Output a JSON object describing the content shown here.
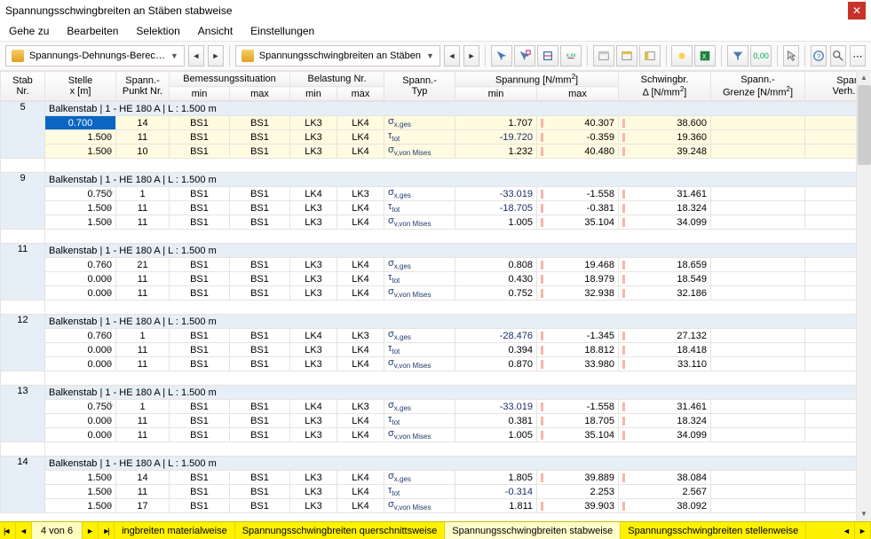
{
  "title": "Spannungsschwingbreiten an Stäben stabweise",
  "menu": [
    "Gehe zu",
    "Bearbeiten",
    "Selektion",
    "Ansicht",
    "Einstellungen"
  ],
  "toolbar": {
    "drop1": "Spannungs-Dehnungs-Berec…",
    "drop2": "Spannungsschwingbreiten an Stäben"
  },
  "headers": {
    "nr": "Stab\nNr.",
    "stelle": "Stelle\nx [m]",
    "punkt": "Spann.-\nPunkt Nr.",
    "bs": "Bemessungssituation",
    "bs_min": "min",
    "bs_max": "max",
    "lk": "Belastung Nr.",
    "lk_min": "min",
    "lk_max": "max",
    "typ": "Spann.-\nTyp",
    "spn": "Spannung [N/mm²]",
    "spn_min": "min",
    "spn_max": "max",
    "delta": "Schwingbr.\nΔ [N/mm²]",
    "grenze": "Spann.-\nGrenze [N/mm²]",
    "verh": "Spann.-\nVerh. η [-]"
  },
  "groups": [
    {
      "nr": "5",
      "label": "Balkenstab | 1 - HE 180 A | L : 1.500 m",
      "rows": [
        {
          "sel": true,
          "stelle": "0.700",
          "glyph": "",
          "punkt": "14",
          "bsmin": "BS1",
          "bsmax": "BS1",
          "lkmin": "LK3",
          "lkmax": "LK4",
          "typ": "σ<sub>x,ges</sub>",
          "smin": "1.707",
          "smax": "40.307",
          "delta": "38.600",
          "bar": true
        },
        {
          "sel": true,
          "stelle": "1.500",
          "glyph": "⊼",
          "punkt": "11",
          "bsmin": "BS1",
          "bsmax": "BS1",
          "lkmin": "LK3",
          "lkmax": "LK4",
          "typ": "τ<sub>tot</sub>",
          "smin": "-19.720",
          "smax": "-0.359",
          "delta": "19.360",
          "bar": true
        },
        {
          "sel": true,
          "stelle": "1.500",
          "glyph": "⊼",
          "punkt": "10",
          "bsmin": "BS1",
          "bsmax": "BS1",
          "lkmin": "LK3",
          "lkmax": "LK4",
          "typ": "σ<sub>v,von Mises</sub>",
          "smin": "1.232",
          "smax": "40.480",
          "delta": "39.248",
          "bar": true
        }
      ]
    },
    {
      "nr": "9",
      "label": "Balkenstab | 1 - HE 180 A | L : 1.500 m",
      "rows": [
        {
          "stelle": "0.750",
          "frac": "¹/₂",
          "punkt": "1",
          "bsmin": "BS1",
          "bsmax": "BS1",
          "lkmin": "LK4",
          "lkmax": "LK3",
          "typ": "σ<sub>x,ges</sub>",
          "smin": "-33.019",
          "smax": "-1.558",
          "delta": "31.461",
          "bar": true
        },
        {
          "stelle": "1.500",
          "glyph": "⊼",
          "punkt": "11",
          "bsmin": "BS1",
          "bsmax": "BS1",
          "lkmin": "LK3",
          "lkmax": "LK4",
          "typ": "τ<sub>tot</sub>",
          "smin": "-18.705",
          "smax": "-0.381",
          "delta": "18.324",
          "bar": true
        },
        {
          "stelle": "1.500",
          "glyph": "⊼",
          "punkt": "11",
          "bsmin": "BS1",
          "bsmax": "BS1",
          "lkmin": "LK3",
          "lkmax": "LK4",
          "typ": "σ<sub>v,von Mises</sub>",
          "smin": "1.005",
          "smax": "35.104",
          "delta": "34.099",
          "bar": true
        }
      ]
    },
    {
      "nr": "11",
      "label": "Balkenstab | 1 - HE 180 A | L : 1.500 m",
      "rows": [
        {
          "stelle": "0.760",
          "glyph": "",
          "punkt": "21",
          "bsmin": "BS1",
          "bsmax": "BS1",
          "lkmin": "LK3",
          "lkmax": "LK4",
          "typ": "σ<sub>x,ges</sub>",
          "smin": "0.808",
          "smax": "19.468",
          "delta": "18.659",
          "bar": true
        },
        {
          "stelle": "0.000",
          "glyph": "⊼",
          "punkt": "11",
          "bsmin": "BS1",
          "bsmax": "BS1",
          "lkmin": "LK3",
          "lkmax": "LK4",
          "typ": "τ<sub>tot</sub>",
          "smin": "0.430",
          "smax": "18.979",
          "delta": "18.549",
          "bar": true
        },
        {
          "stelle": "0.000",
          "glyph": "⊼",
          "punkt": "11",
          "bsmin": "BS1",
          "bsmax": "BS1",
          "lkmin": "LK3",
          "lkmax": "LK4",
          "typ": "σ<sub>v,von Mises</sub>",
          "smin": "0.752",
          "smax": "32.938",
          "delta": "32.186",
          "bar": true
        }
      ]
    },
    {
      "nr": "12",
      "label": "Balkenstab | 1 - HE 180 A | L : 1.500 m",
      "rows": [
        {
          "stelle": "0.760",
          "glyph": "",
          "punkt": "1",
          "bsmin": "BS1",
          "bsmax": "BS1",
          "lkmin": "LK4",
          "lkmax": "LK3",
          "typ": "σ<sub>x,ges</sub>",
          "smin": "-28.476",
          "smax": "-1.345",
          "delta": "27.132",
          "bar": true
        },
        {
          "stelle": "0.000",
          "glyph": "⊼",
          "punkt": "11",
          "bsmin": "BS1",
          "bsmax": "BS1",
          "lkmin": "LK3",
          "lkmax": "LK4",
          "typ": "τ<sub>tot</sub>",
          "smin": "0.394",
          "smax": "18.812",
          "delta": "18.418",
          "bar": true
        },
        {
          "stelle": "0.000",
          "glyph": "⊼",
          "punkt": "11",
          "bsmin": "BS1",
          "bsmax": "BS1",
          "lkmin": "LK3",
          "lkmax": "LK4",
          "typ": "σ<sub>v,von Mises</sub>",
          "smin": "0.870",
          "smax": "33.980",
          "delta": "33.110",
          "bar": true
        }
      ]
    },
    {
      "nr": "13",
      "label": "Balkenstab | 1 - HE 180 A | L : 1.500 m",
      "rows": [
        {
          "stelle": "0.750",
          "frac": "¹/₂",
          "punkt": "1",
          "bsmin": "BS1",
          "bsmax": "BS1",
          "lkmin": "LK4",
          "lkmax": "LK3",
          "typ": "σ<sub>x,ges</sub>",
          "smin": "-33.019",
          "smax": "-1.558",
          "delta": "31.461",
          "bar": true
        },
        {
          "stelle": "0.000",
          "glyph": "⊼",
          "punkt": "11",
          "bsmin": "BS1",
          "bsmax": "BS1",
          "lkmin": "LK3",
          "lkmax": "LK4",
          "typ": "τ<sub>tot</sub>",
          "smin": "0.381",
          "smax": "18.705",
          "delta": "18.324",
          "bar": true
        },
        {
          "stelle": "0.000",
          "glyph": "⊼",
          "punkt": "11",
          "bsmin": "BS1",
          "bsmax": "BS1",
          "lkmin": "LK3",
          "lkmax": "LK4",
          "typ": "σ<sub>v,von Mises</sub>",
          "smin": "1.005",
          "smax": "35.104",
          "delta": "34.099",
          "bar": true
        }
      ]
    },
    {
      "nr": "14",
      "label": "Balkenstab | 1 - HE 180 A | L : 1.500 m",
      "rows": [
        {
          "stelle": "1.500",
          "glyph": "⊼",
          "punkt": "14",
          "bsmin": "BS1",
          "bsmax": "BS1",
          "lkmin": "LK3",
          "lkmax": "LK4",
          "typ": "σ<sub>x,ges</sub>",
          "smin": "1.805",
          "smax": "39.889",
          "delta": "38.084",
          "bar": true
        },
        {
          "stelle": "1.500",
          "glyph": "⊼",
          "punkt": "11",
          "bsmin": "BS1",
          "bsmax": "BS1",
          "lkmin": "LK3",
          "lkmax": "LK4",
          "typ": "τ<sub>tot</sub>",
          "smin": "-0.314",
          "smax": "2.253",
          "delta": "2.567",
          "bar": false
        },
        {
          "stelle": "1.500",
          "glyph": "⊼",
          "punkt": "17",
          "bsmin": "BS1",
          "bsmax": "BS1",
          "lkmin": "LK3",
          "lkmax": "LK4",
          "typ": "σ<sub>v,von Mises</sub>",
          "smin": "1.811",
          "smax": "39.903",
          "delta": "38.092",
          "bar": true
        }
      ]
    }
  ],
  "footer": {
    "page": "4 von 6",
    "tabs": [
      "ingbreiten materialweise",
      "Spannungsschwingbreiten querschnittsweise",
      "Spannungsschwingbreiten stabweise",
      "Spannungsschwingbreiten stellenweise"
    ],
    "active_tab": 2
  }
}
